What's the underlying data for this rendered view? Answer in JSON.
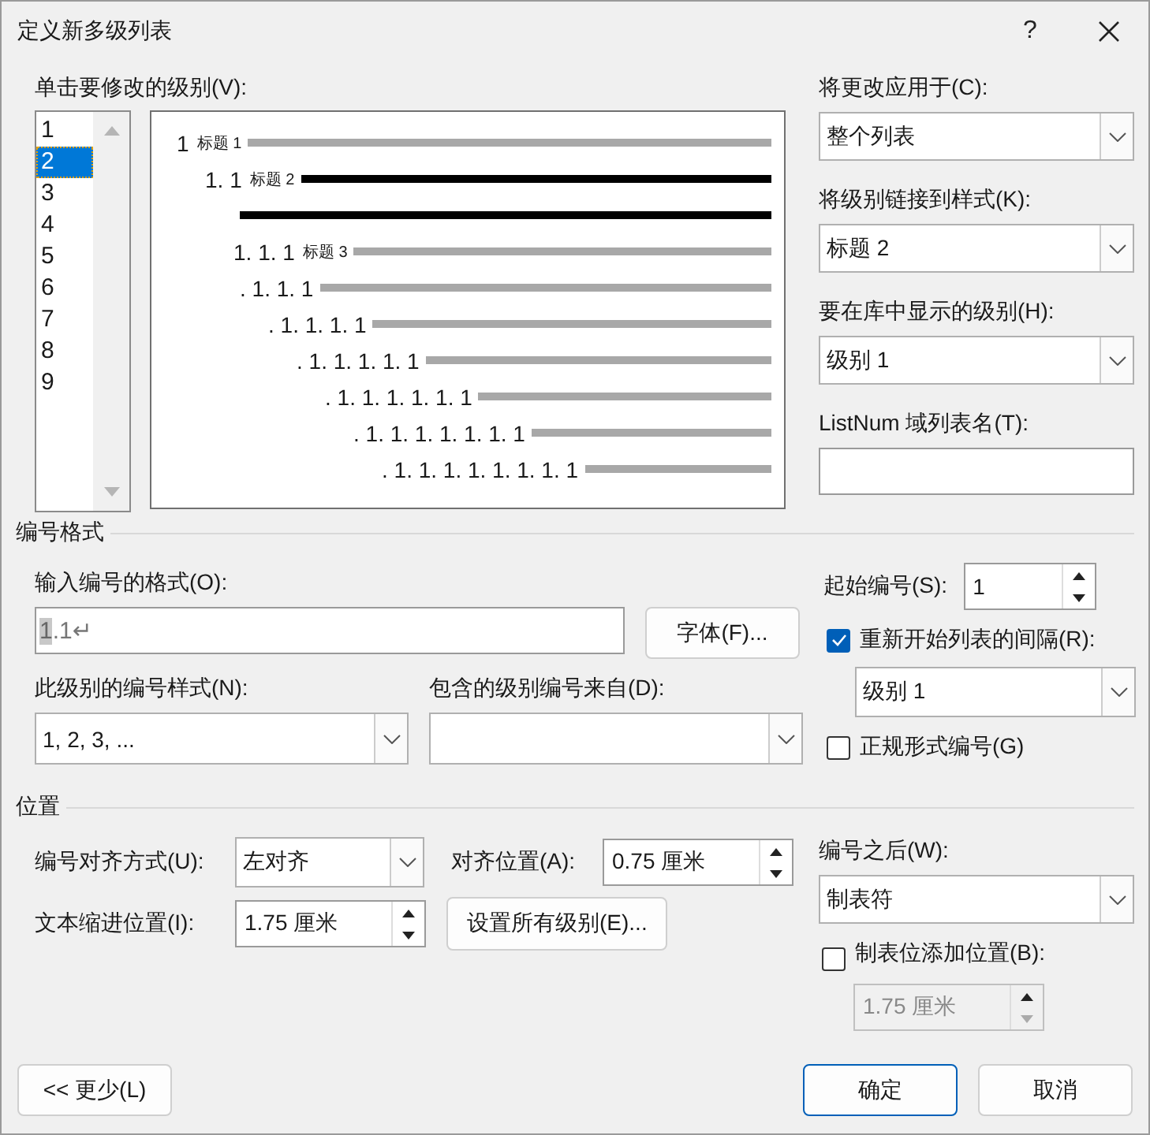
{
  "window": {
    "title": "定义新多级列表",
    "help": "?"
  },
  "level_list": {
    "label": "单击要修改的级别(V):",
    "items": [
      {
        "label": "1",
        "selected": false
      },
      {
        "label": "2",
        "selected": true
      },
      {
        "label": "3",
        "selected": false
      },
      {
        "label": "4",
        "selected": false
      },
      {
        "label": "5",
        "selected": false
      },
      {
        "label": "6",
        "selected": false
      },
      {
        "label": "7",
        "selected": false
      },
      {
        "label": "8",
        "selected": false
      },
      {
        "label": "9",
        "selected": false
      }
    ]
  },
  "preview": {
    "rows": [
      {
        "number": "1",
        "style": "标题 1",
        "selected": false
      },
      {
        "number": "1. 1",
        "style": "标题 2",
        "selected": true
      },
      {
        "number": "1. 1. 1",
        "style": "标题 3",
        "selected": false
      },
      {
        "number": ". 1. 1. 1",
        "selected": false
      },
      {
        "number": ". 1. 1. 1. 1",
        "selected": false
      },
      {
        "number": ". 1. 1. 1. 1. 1",
        "selected": false
      },
      {
        "number": ". 1. 1. 1. 1. 1. 1",
        "selected": false
      },
      {
        "number": ". 1. 1. 1. 1. 1. 1. 1",
        "selected": false
      },
      {
        "number": ". 1. 1. 1. 1. 1. 1. 1. 1",
        "selected": false
      }
    ]
  },
  "apply_to": {
    "label": "将更改应用于(C):",
    "value": "整个列表"
  },
  "link_style": {
    "label": "将级别链接到样式(K):",
    "value": "标题 2"
  },
  "gallery_level": {
    "label": "要在库中显示的级别(H):",
    "value": "级别 1"
  },
  "listnum": {
    "label": "ListNum 域列表名(T):"
  },
  "number_format": {
    "title": "编号格式",
    "format_label": "输入编号的格式(O):",
    "format_field": "1",
    "format_rest": ".1↵",
    "font_button": "字体(F)...",
    "style_label": "此级别的编号样式(N):",
    "style_value": "1, 2, 3, ...",
    "include_label": "包含的级别编号来自(D):",
    "start_label": "起始编号(S):",
    "start_value": "1",
    "restart": {
      "label": "重新开始列表的间隔(R):",
      "checked": true,
      "value": "级别 1"
    },
    "legal": {
      "label": "正规形式编号(G)",
      "checked": false
    }
  },
  "position": {
    "title": "位置",
    "align_label": "编号对齐方式(U):",
    "align_value": "左对齐",
    "at_label": "对齐位置(A):",
    "at_value": "0.75 厘米",
    "indent_label": "文本缩进位置(I):",
    "indent_value": "1.75 厘米",
    "set_all_button": "设置所有级别(E)...",
    "follow_label": "编号之后(W):",
    "follow_value": "制表符",
    "tab_stop": {
      "label": "制表位添加位置(B):",
      "checked": false,
      "value": "1.75 厘米"
    }
  },
  "buttons": {
    "less": "<< 更少(L)",
    "ok": "确定",
    "cancel": "取消"
  }
}
